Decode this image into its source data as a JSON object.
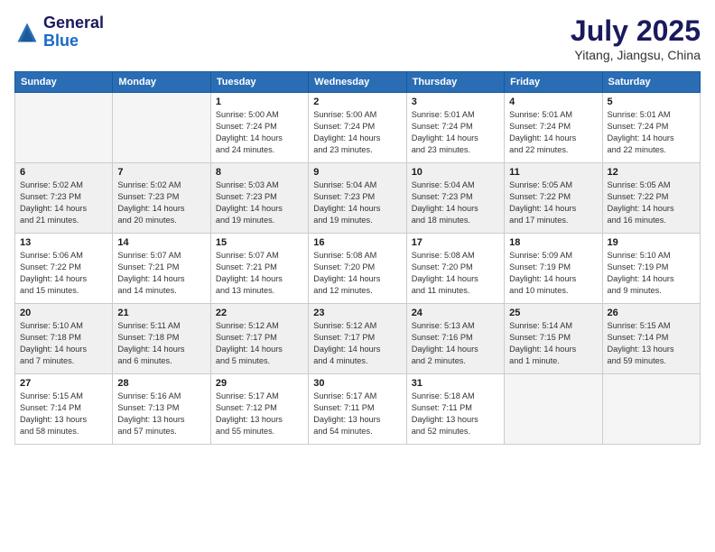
{
  "logo": {
    "general": "General",
    "blue": "Blue"
  },
  "title": {
    "month_year": "July 2025",
    "location": "Yitang, Jiangsu, China"
  },
  "days_of_week": [
    "Sunday",
    "Monday",
    "Tuesday",
    "Wednesday",
    "Thursday",
    "Friday",
    "Saturday"
  ],
  "weeks": [
    {
      "shaded": false,
      "days": [
        {
          "date": "",
          "detail": ""
        },
        {
          "date": "",
          "detail": ""
        },
        {
          "date": "1",
          "detail": "Sunrise: 5:00 AM\nSunset: 7:24 PM\nDaylight: 14 hours\nand 24 minutes."
        },
        {
          "date": "2",
          "detail": "Sunrise: 5:00 AM\nSunset: 7:24 PM\nDaylight: 14 hours\nand 23 minutes."
        },
        {
          "date": "3",
          "detail": "Sunrise: 5:01 AM\nSunset: 7:24 PM\nDaylight: 14 hours\nand 23 minutes."
        },
        {
          "date": "4",
          "detail": "Sunrise: 5:01 AM\nSunset: 7:24 PM\nDaylight: 14 hours\nand 22 minutes."
        },
        {
          "date": "5",
          "detail": "Sunrise: 5:01 AM\nSunset: 7:24 PM\nDaylight: 14 hours\nand 22 minutes."
        }
      ]
    },
    {
      "shaded": true,
      "days": [
        {
          "date": "6",
          "detail": "Sunrise: 5:02 AM\nSunset: 7:23 PM\nDaylight: 14 hours\nand 21 minutes."
        },
        {
          "date": "7",
          "detail": "Sunrise: 5:02 AM\nSunset: 7:23 PM\nDaylight: 14 hours\nand 20 minutes."
        },
        {
          "date": "8",
          "detail": "Sunrise: 5:03 AM\nSunset: 7:23 PM\nDaylight: 14 hours\nand 19 minutes."
        },
        {
          "date": "9",
          "detail": "Sunrise: 5:04 AM\nSunset: 7:23 PM\nDaylight: 14 hours\nand 19 minutes."
        },
        {
          "date": "10",
          "detail": "Sunrise: 5:04 AM\nSunset: 7:23 PM\nDaylight: 14 hours\nand 18 minutes."
        },
        {
          "date": "11",
          "detail": "Sunrise: 5:05 AM\nSunset: 7:22 PM\nDaylight: 14 hours\nand 17 minutes."
        },
        {
          "date": "12",
          "detail": "Sunrise: 5:05 AM\nSunset: 7:22 PM\nDaylight: 14 hours\nand 16 minutes."
        }
      ]
    },
    {
      "shaded": false,
      "days": [
        {
          "date": "13",
          "detail": "Sunrise: 5:06 AM\nSunset: 7:22 PM\nDaylight: 14 hours\nand 15 minutes."
        },
        {
          "date": "14",
          "detail": "Sunrise: 5:07 AM\nSunset: 7:21 PM\nDaylight: 14 hours\nand 14 minutes."
        },
        {
          "date": "15",
          "detail": "Sunrise: 5:07 AM\nSunset: 7:21 PM\nDaylight: 14 hours\nand 13 minutes."
        },
        {
          "date": "16",
          "detail": "Sunrise: 5:08 AM\nSunset: 7:20 PM\nDaylight: 14 hours\nand 12 minutes."
        },
        {
          "date": "17",
          "detail": "Sunrise: 5:08 AM\nSunset: 7:20 PM\nDaylight: 14 hours\nand 11 minutes."
        },
        {
          "date": "18",
          "detail": "Sunrise: 5:09 AM\nSunset: 7:19 PM\nDaylight: 14 hours\nand 10 minutes."
        },
        {
          "date": "19",
          "detail": "Sunrise: 5:10 AM\nSunset: 7:19 PM\nDaylight: 14 hours\nand 9 minutes."
        }
      ]
    },
    {
      "shaded": true,
      "days": [
        {
          "date": "20",
          "detail": "Sunrise: 5:10 AM\nSunset: 7:18 PM\nDaylight: 14 hours\nand 7 minutes."
        },
        {
          "date": "21",
          "detail": "Sunrise: 5:11 AM\nSunset: 7:18 PM\nDaylight: 14 hours\nand 6 minutes."
        },
        {
          "date": "22",
          "detail": "Sunrise: 5:12 AM\nSunset: 7:17 PM\nDaylight: 14 hours\nand 5 minutes."
        },
        {
          "date": "23",
          "detail": "Sunrise: 5:12 AM\nSunset: 7:17 PM\nDaylight: 14 hours\nand 4 minutes."
        },
        {
          "date": "24",
          "detail": "Sunrise: 5:13 AM\nSunset: 7:16 PM\nDaylight: 14 hours\nand 2 minutes."
        },
        {
          "date": "25",
          "detail": "Sunrise: 5:14 AM\nSunset: 7:15 PM\nDaylight: 14 hours\nand 1 minute."
        },
        {
          "date": "26",
          "detail": "Sunrise: 5:15 AM\nSunset: 7:14 PM\nDaylight: 13 hours\nand 59 minutes."
        }
      ]
    },
    {
      "shaded": false,
      "days": [
        {
          "date": "27",
          "detail": "Sunrise: 5:15 AM\nSunset: 7:14 PM\nDaylight: 13 hours\nand 58 minutes."
        },
        {
          "date": "28",
          "detail": "Sunrise: 5:16 AM\nSunset: 7:13 PM\nDaylight: 13 hours\nand 57 minutes."
        },
        {
          "date": "29",
          "detail": "Sunrise: 5:17 AM\nSunset: 7:12 PM\nDaylight: 13 hours\nand 55 minutes."
        },
        {
          "date": "30",
          "detail": "Sunrise: 5:17 AM\nSunset: 7:11 PM\nDaylight: 13 hours\nand 54 minutes."
        },
        {
          "date": "31",
          "detail": "Sunrise: 5:18 AM\nSunset: 7:11 PM\nDaylight: 13 hours\nand 52 minutes."
        },
        {
          "date": "",
          "detail": ""
        },
        {
          "date": "",
          "detail": ""
        }
      ]
    }
  ]
}
